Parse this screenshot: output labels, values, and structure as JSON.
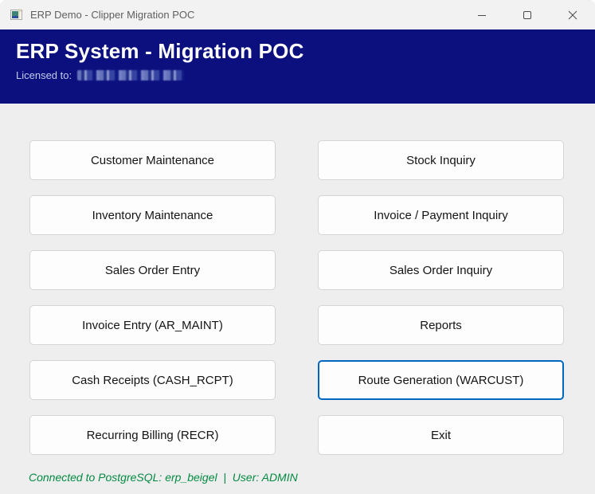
{
  "titlebar": {
    "title": "ERP Demo - Clipper Migration POC"
  },
  "header": {
    "title": "ERP System - Migration POC",
    "license_label": "Licensed to:",
    "licensee": "(redacted/blurred)"
  },
  "menu": {
    "buttons": [
      {
        "label": "Customer Maintenance"
      },
      {
        "label": "Stock Inquiry"
      },
      {
        "label": "Inventory Maintenance"
      },
      {
        "label": "Invoice / Payment Inquiry"
      },
      {
        "label": "Sales Order Entry"
      },
      {
        "label": "Sales Order Inquiry"
      },
      {
        "label": "Invoice Entry (AR_MAINT)"
      },
      {
        "label": "Reports"
      },
      {
        "label": "Cash Receipts (CASH_RCPT)"
      },
      {
        "label": "Route Generation (WARCUST)",
        "focused": true
      },
      {
        "label": "Recurring Billing (RECR)"
      },
      {
        "label": "Exit"
      }
    ]
  },
  "status": {
    "text": "Connected to PostgreSQL: erp_beigel  |  User: ADMIN"
  },
  "icons": {
    "app": "tk-app-icon",
    "minimize": "minimize-icon",
    "maximize": "maximize-icon",
    "close": "close-icon"
  },
  "colors": {
    "header_bg": "#0b107e",
    "focus_accent": "#0067c0",
    "status_green": "#028a42",
    "content_bg": "#efeeee",
    "titlebar_bg": "#f3f2f2"
  }
}
